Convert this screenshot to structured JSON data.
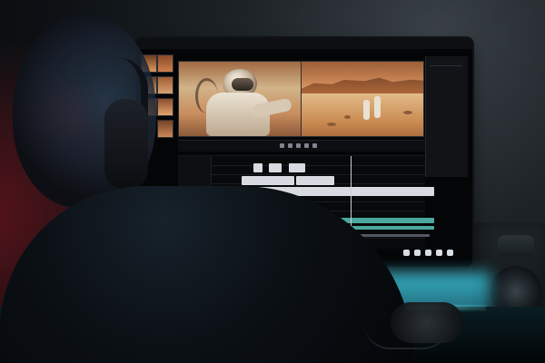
{
  "scene": {
    "monitor": {
      "top_labels": [
        "",
        "",
        "",
        ""
      ],
      "inspector": {
        "links": [
          "",
          ""
        ],
        "labels": [
          "",
          "",
          "",
          "",
          "",
          "",
          "",
          "",
          "",
          "",
          "",
          ""
        ]
      },
      "timeline": {
        "timecodes": [
          "",
          ""
        ],
        "track_labels": [
          "",
          "",
          "",
          "",
          "",
          "",
          "",
          "",
          "",
          "",
          ""
        ]
      }
    }
  }
}
